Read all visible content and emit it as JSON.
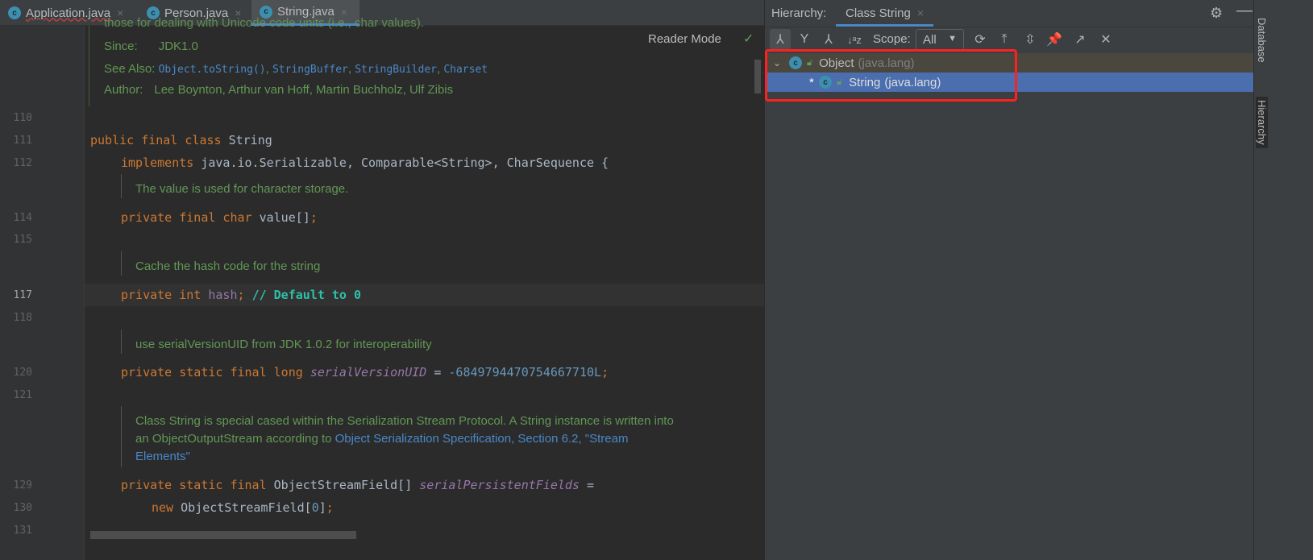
{
  "tabs": [
    {
      "label": "Application.java",
      "close": "×",
      "error": true
    },
    {
      "label": "Person.java",
      "close": "×"
    },
    {
      "label": "String.java",
      "close": "×",
      "active": true
    }
  ],
  "editor": {
    "reader_mode": "Reader Mode",
    "doc_header": {
      "partial": "those for dealing with Unicode code units (i.e., char values).",
      "since_label": "Since:",
      "since": "JDK1.0",
      "see_label": "See Also:",
      "see": [
        "Object.toString()",
        "StringBuffer",
        "StringBuilder",
        "Charset"
      ],
      "author_label": "Author:",
      "author": "Lee Boynton, Arthur van Hoff, Martin Buchholz, Ulf Zibis"
    },
    "current_line": "117",
    "lines": [
      {
        "num": "110",
        "indent": 0,
        "tokens": []
      },
      {
        "num": "111",
        "indent": 0,
        "tokens": [
          {
            "t": "public final class ",
            "c": "k"
          },
          {
            "t": "String"
          }
        ]
      },
      {
        "num": "112",
        "indent": 1,
        "tokens": [
          {
            "t": "implements ",
            "c": "k"
          },
          {
            "t": "java.io.Serializable, Comparable<String>, CharSequence {"
          }
        ]
      },
      {
        "doc": "The value is used for character storage."
      },
      {
        "num": "114",
        "indent": 1,
        "tokens": [
          {
            "t": "private final char ",
            "c": "k"
          },
          {
            "t": "value[]"
          },
          {
            "t": ";",
            "c": "k"
          }
        ]
      },
      {
        "num": "115",
        "indent": 0,
        "tokens": []
      },
      {
        "doc": "Cache the hash code for the string"
      },
      {
        "num": "117",
        "indent": 1,
        "tokens": [
          {
            "t": "private int ",
            "c": "k"
          },
          {
            "t": "hash",
            "c": "f2"
          },
          {
            "t": "; ",
            "c": "k"
          },
          {
            "t": "// Default to 0",
            "c": "cm"
          }
        ]
      },
      {
        "num": "118",
        "indent": 0,
        "tokens": []
      },
      {
        "doc": "use serialVersionUID from JDK 1.0.2 for interoperability"
      },
      {
        "num": "120",
        "indent": 1,
        "tokens": [
          {
            "t": "private static final long ",
            "c": "k"
          },
          {
            "t": "serialVersionUID",
            "c": "f"
          },
          {
            "t": " = "
          },
          {
            "t": "-6849794470754667710L",
            "c": "n"
          },
          {
            "t": ";",
            "c": "k"
          }
        ]
      },
      {
        "num": "121",
        "indent": 0,
        "tokens": []
      },
      {
        "doc": "Class String is special cased within the Serialization Stream Protocol. A String instance is written into",
        "doc2": "an ObjectOutputStream according to ",
        "link": "Object Serialization Specification, Section 6.2, \"Stream",
        "link2": "Elements\""
      },
      {
        "num": "129",
        "indent": 1,
        "tokens": [
          {
            "t": "private static final ",
            "c": "k"
          },
          {
            "t": "ObjectStreamField[] "
          },
          {
            "t": "serialPersistentFields",
            "c": "f"
          },
          {
            "t": " ="
          }
        ]
      },
      {
        "num": "130",
        "indent": 2,
        "tokens": [
          {
            "t": "new ",
            "c": "k"
          },
          {
            "t": "ObjectStreamField["
          },
          {
            "t": "0",
            "c": "n"
          },
          {
            "t": "]"
          },
          {
            "t": ";",
            "c": "k"
          }
        ]
      },
      {
        "num": "131",
        "indent": 0,
        "tokens": []
      }
    ]
  },
  "hierarchy": {
    "label": "Hierarchy:",
    "tab": "Class String",
    "close": "×",
    "scope_label": "Scope:",
    "scope_value": "All",
    "tree": [
      {
        "name": "Object",
        "pkg": "(java.lang)",
        "expanded": true
      },
      {
        "marker": "*",
        "name": "String",
        "pkg": "(java.lang)",
        "selected": true
      }
    ]
  },
  "side_tools": [
    "Database",
    "Hierarchy"
  ],
  "colors": {
    "accent": "#4a88c7",
    "selection": "#4b6eaf",
    "highlight": "#ff2020",
    "keyword": "#cc7832",
    "doc": "#629755"
  }
}
